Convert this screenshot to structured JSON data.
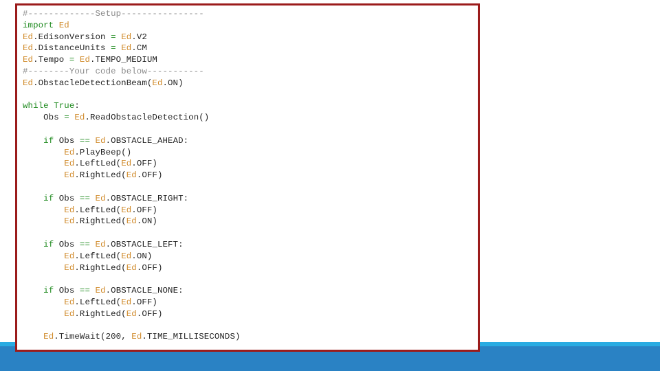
{
  "colors": {
    "border": "#9b1b1b",
    "bar_light": "#29abe2",
    "bar_dark": "#2a82c4",
    "comment": "#8a8a8a",
    "keyword": "#1f8a1f",
    "module": "#d08a2a",
    "text": "#222222"
  },
  "code": {
    "lines": [
      [
        {
          "t": "comment",
          "v": "#-------------Setup----------------"
        }
      ],
      [
        {
          "t": "kw",
          "v": "import "
        },
        {
          "t": "mod",
          "v": "Ed"
        }
      ],
      [
        {
          "t": "mod",
          "v": "Ed"
        },
        {
          "t": "txt",
          "v": ".EdisonVersion "
        },
        {
          "t": "op",
          "v": "="
        },
        {
          "t": "txt",
          "v": " "
        },
        {
          "t": "mod",
          "v": "Ed"
        },
        {
          "t": "txt",
          "v": ".V2"
        }
      ],
      [
        {
          "t": "mod",
          "v": "Ed"
        },
        {
          "t": "txt",
          "v": ".DistanceUnits "
        },
        {
          "t": "op",
          "v": "="
        },
        {
          "t": "txt",
          "v": " "
        },
        {
          "t": "mod",
          "v": "Ed"
        },
        {
          "t": "txt",
          "v": ".CM"
        }
      ],
      [
        {
          "t": "mod",
          "v": "Ed"
        },
        {
          "t": "txt",
          "v": ".Tempo "
        },
        {
          "t": "op",
          "v": "="
        },
        {
          "t": "txt",
          "v": " "
        },
        {
          "t": "mod",
          "v": "Ed"
        },
        {
          "t": "txt",
          "v": ".TEMPO_MEDIUM"
        }
      ],
      [
        {
          "t": "comment",
          "v": "#--------Your code below-----------"
        }
      ],
      [
        {
          "t": "mod",
          "v": "Ed"
        },
        {
          "t": "txt",
          "v": ".ObstacleDetectionBeam("
        },
        {
          "t": "mod",
          "v": "Ed"
        },
        {
          "t": "txt",
          "v": ".ON)"
        }
      ],
      [],
      [
        {
          "t": "kw",
          "v": "while True"
        },
        {
          "t": "txt",
          "v": ":"
        }
      ],
      [
        {
          "t": "txt",
          "v": "    Obs "
        },
        {
          "t": "op",
          "v": "="
        },
        {
          "t": "txt",
          "v": " "
        },
        {
          "t": "mod",
          "v": "Ed"
        },
        {
          "t": "txt",
          "v": ".ReadObstacleDetection()"
        }
      ],
      [],
      [
        {
          "t": "txt",
          "v": "    "
        },
        {
          "t": "kw",
          "v": "if"
        },
        {
          "t": "txt",
          "v": " Obs "
        },
        {
          "t": "op",
          "v": "=="
        },
        {
          "t": "txt",
          "v": " "
        },
        {
          "t": "mod",
          "v": "Ed"
        },
        {
          "t": "txt",
          "v": ".OBSTACLE_AHEAD:"
        }
      ],
      [
        {
          "t": "txt",
          "v": "        "
        },
        {
          "t": "mod",
          "v": "Ed"
        },
        {
          "t": "txt",
          "v": ".PlayBeep()"
        }
      ],
      [
        {
          "t": "txt",
          "v": "        "
        },
        {
          "t": "mod",
          "v": "Ed"
        },
        {
          "t": "txt",
          "v": ".LeftLed("
        },
        {
          "t": "mod",
          "v": "Ed"
        },
        {
          "t": "txt",
          "v": ".OFF)"
        }
      ],
      [
        {
          "t": "txt",
          "v": "        "
        },
        {
          "t": "mod",
          "v": "Ed"
        },
        {
          "t": "txt",
          "v": ".RightLed("
        },
        {
          "t": "mod",
          "v": "Ed"
        },
        {
          "t": "txt",
          "v": ".OFF)"
        }
      ],
      [],
      [
        {
          "t": "txt",
          "v": "    "
        },
        {
          "t": "kw",
          "v": "if"
        },
        {
          "t": "txt",
          "v": " Obs "
        },
        {
          "t": "op",
          "v": "=="
        },
        {
          "t": "txt",
          "v": " "
        },
        {
          "t": "mod",
          "v": "Ed"
        },
        {
          "t": "txt",
          "v": ".OBSTACLE_RIGHT:"
        }
      ],
      [
        {
          "t": "txt",
          "v": "        "
        },
        {
          "t": "mod",
          "v": "Ed"
        },
        {
          "t": "txt",
          "v": ".LeftLed("
        },
        {
          "t": "mod",
          "v": "Ed"
        },
        {
          "t": "txt",
          "v": ".OFF)"
        }
      ],
      [
        {
          "t": "txt",
          "v": "        "
        },
        {
          "t": "mod",
          "v": "Ed"
        },
        {
          "t": "txt",
          "v": ".RightLed("
        },
        {
          "t": "mod",
          "v": "Ed"
        },
        {
          "t": "txt",
          "v": ".ON)"
        }
      ],
      [],
      [
        {
          "t": "txt",
          "v": "    "
        },
        {
          "t": "kw",
          "v": "if"
        },
        {
          "t": "txt",
          "v": " Obs "
        },
        {
          "t": "op",
          "v": "=="
        },
        {
          "t": "txt",
          "v": " "
        },
        {
          "t": "mod",
          "v": "Ed"
        },
        {
          "t": "txt",
          "v": ".OBSTACLE_LEFT:"
        }
      ],
      [
        {
          "t": "txt",
          "v": "        "
        },
        {
          "t": "mod",
          "v": "Ed"
        },
        {
          "t": "txt",
          "v": ".LeftLed("
        },
        {
          "t": "mod",
          "v": "Ed"
        },
        {
          "t": "txt",
          "v": ".ON)"
        }
      ],
      [
        {
          "t": "txt",
          "v": "        "
        },
        {
          "t": "mod",
          "v": "Ed"
        },
        {
          "t": "txt",
          "v": ".RightLed("
        },
        {
          "t": "mod",
          "v": "Ed"
        },
        {
          "t": "txt",
          "v": ".OFF)"
        }
      ],
      [],
      [
        {
          "t": "txt",
          "v": "    "
        },
        {
          "t": "kw",
          "v": "if"
        },
        {
          "t": "txt",
          "v": " Obs "
        },
        {
          "t": "op",
          "v": "=="
        },
        {
          "t": "txt",
          "v": " "
        },
        {
          "t": "mod",
          "v": "Ed"
        },
        {
          "t": "txt",
          "v": ".OBSTACLE_NONE:"
        }
      ],
      [
        {
          "t": "txt",
          "v": "        "
        },
        {
          "t": "mod",
          "v": "Ed"
        },
        {
          "t": "txt",
          "v": ".LeftLed("
        },
        {
          "t": "mod",
          "v": "Ed"
        },
        {
          "t": "txt",
          "v": ".OFF)"
        }
      ],
      [
        {
          "t": "txt",
          "v": "        "
        },
        {
          "t": "mod",
          "v": "Ed"
        },
        {
          "t": "txt",
          "v": ".RightLed("
        },
        {
          "t": "mod",
          "v": "Ed"
        },
        {
          "t": "txt",
          "v": ".OFF)"
        }
      ],
      [],
      [
        {
          "t": "txt",
          "v": "    "
        },
        {
          "t": "mod",
          "v": "Ed"
        },
        {
          "t": "txt",
          "v": ".TimeWait(200, "
        },
        {
          "t": "mod",
          "v": "Ed"
        },
        {
          "t": "txt",
          "v": ".TIME_MILLISECONDS)"
        }
      ]
    ]
  }
}
